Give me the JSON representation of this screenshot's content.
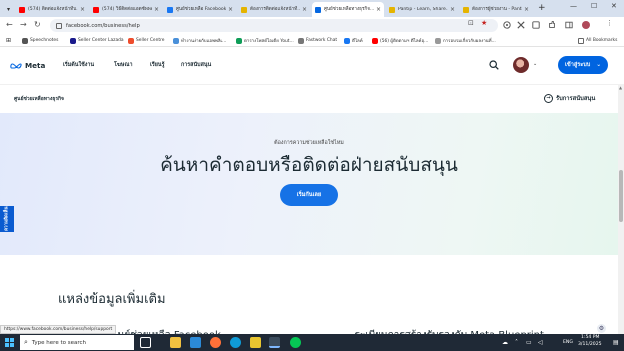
{
  "browser": {
    "tabs": [
      {
        "label": "(574) ติดต่อแจ้งหน้าที่บ...",
        "icon": "youtube-icon",
        "color": "#ff0000"
      },
      {
        "label": "(574) วิธีติดต่อแอดซัพพอร์ต...",
        "icon": "youtube-icon",
        "color": "#ff0000"
      },
      {
        "label": "ศูนย์ช่วยเหลือ Facebook -...",
        "icon": "facebook-icon",
        "color": "#1877f2"
      },
      {
        "label": "ต้องการติดต่อแจ้งหน้าที่...",
        "icon": "pantip-icon",
        "color": "#e5b400"
      },
      {
        "label": "ศูนย์ช่วยเหลือทางธุรกิจ...",
        "icon": "meta-icon",
        "color": "#0668e1",
        "active": true
      },
      {
        "label": "Pantip - Learn, Share...",
        "icon": "pantip-icon",
        "color": "#e5b400"
      },
      {
        "label": "ต้องการผู้ช่วยงาน - Pantip",
        "icon": "pantip-icon",
        "color": "#e5b400"
      }
    ],
    "new_tab": "+",
    "address": "facebook.com/business/help",
    "bookmarks": [
      {
        "label": "Speechnotes",
        "icon": "speechnotes-icon",
        "color": "#555555"
      },
      {
        "label": "Seller Center Lazada",
        "icon": "lazada-icon",
        "color": "#1a1a8c"
      },
      {
        "label": "Seller Centre",
        "icon": "shopee-icon",
        "color": "#ee4d2d"
      },
      {
        "label": "ทำงานง่ายกับแอพพลิเ...",
        "icon": "globe-icon",
        "color": "#4a90d9"
      },
      {
        "label": "ตารางโพสต์ไอเดีย Yout...",
        "icon": "sheets-icon",
        "color": "#0f9d58"
      },
      {
        "label": "Fastwork Chat",
        "icon": "document-icon",
        "color": "#777777"
      },
      {
        "label": "ตีไลค์",
        "icon": "facebook-icon",
        "color": "#1877f2"
      },
      {
        "label": "(56) ผู้ติดตามฯ ตีไลค์อุ...",
        "icon": "youtube-icon",
        "color": "#ff0000"
      },
      {
        "label": "การอบรมเกี่ยวกับผลงานที่...",
        "icon": "globe-icon",
        "color": "#999999"
      }
    ],
    "all_bookmarks": "All Bookmarks"
  },
  "site": {
    "logo": "Meta",
    "nav": [
      "เริ่มต้นใช้งาน",
      "โฆษณา",
      "เรียนรู้",
      "การสนับสนุน"
    ],
    "login": "เข้าสู่ระบบ",
    "subnav_title": "ศูนย์ช่วยเหลือทางธุรกิจ",
    "subnav_support": "รับการสนับสนุน",
    "hero_sub": "ต้องการความช่วยเหลือใช่ไหม",
    "hero_title": "ค้นหาคำตอบหรือติดต่อฝ่ายสนับสนุน",
    "hero_button": "เริ่มกันเลย",
    "side_tab": "ความคิดเห็น",
    "resources_title": "แหล่งข้อมูลเพิ่มเติม",
    "resource_items": [
      "...นย์ช่วยเหลือ Facebook",
      "...ระเบียนการสร้างรับรองกับ Meta Blueprint"
    ]
  },
  "status_url": "https://www.facebook.com/business/help/support",
  "taskbar": {
    "search_placeholder": "Type here to search",
    "language": "ENG",
    "time": "1:54 PM",
    "date": "3/11/2025"
  },
  "colors": {
    "accent": "#0064e0",
    "hero_button": "#1672e6",
    "taskbar": "#1f2936"
  }
}
